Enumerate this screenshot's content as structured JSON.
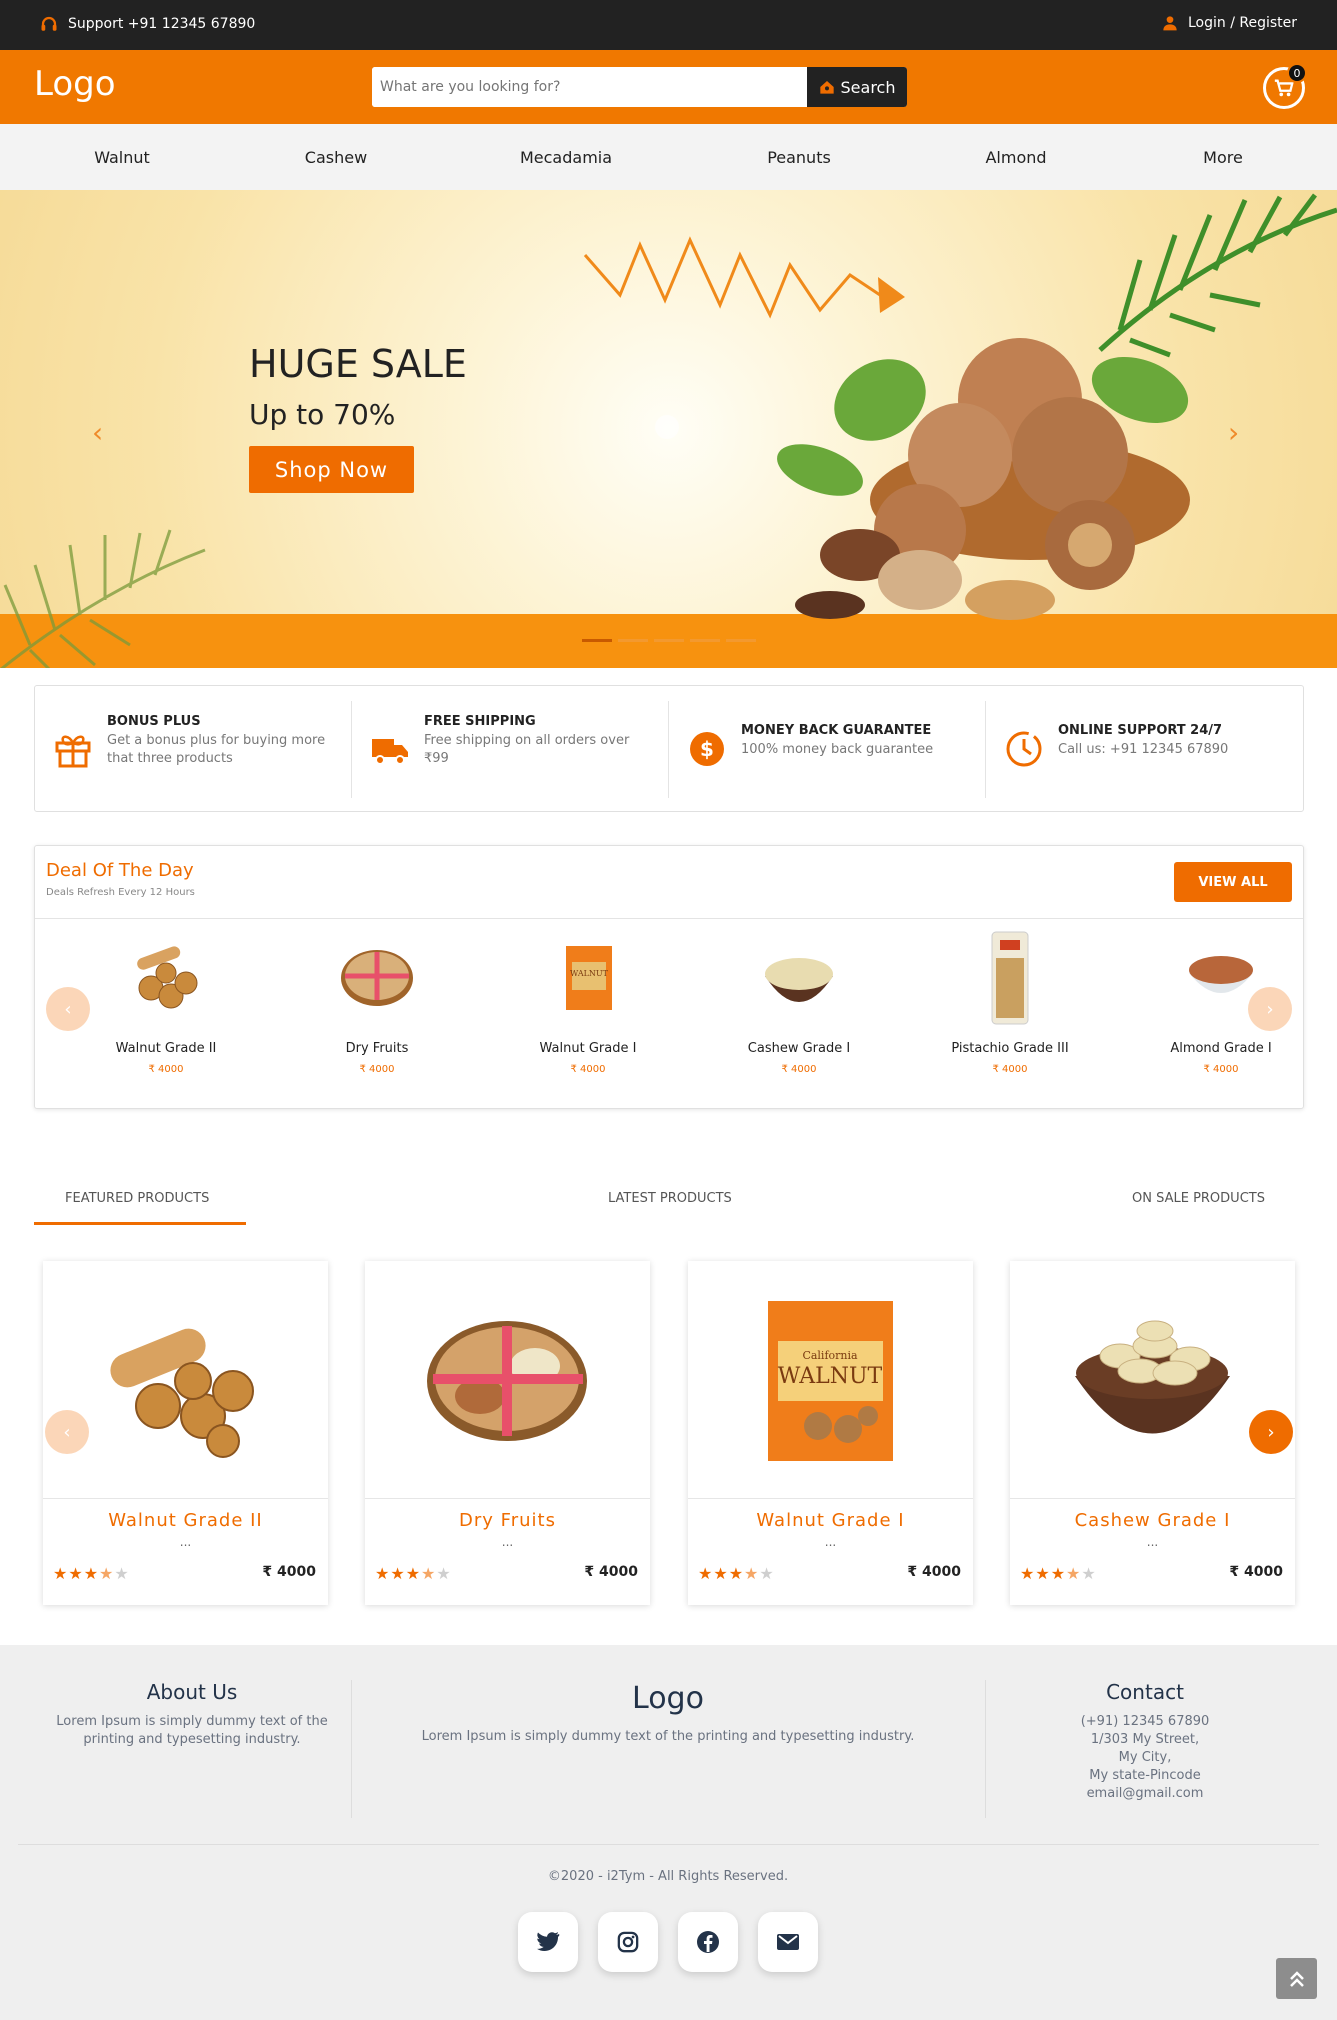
{
  "topbar": {
    "support": "Support +91 12345 67890",
    "login": "Login / Register"
  },
  "header": {
    "logo": "Logo",
    "search_placeholder": "What are you looking for?",
    "search_button": "Search",
    "cart_count": "0"
  },
  "nav": {
    "items": [
      "Walnut",
      "Cashew",
      "Mecadamia",
      "Peanuts",
      "Almond",
      "More"
    ]
  },
  "hero": {
    "title": "HUGE SALE",
    "subtitle": "Up to 70%",
    "cta": "Shop Now",
    "slide_count": 5,
    "active_slide": 1
  },
  "features": [
    {
      "title": "BONUS PLUS",
      "desc": "Get a bonus plus for buying more that three products",
      "icon": "gift-icon"
    },
    {
      "title": "FREE SHIPPING",
      "desc": "Free shipping on all orders over ₹99",
      "icon": "truck-icon"
    },
    {
      "title": "MONEY BACK GUARANTEE",
      "desc": "100% money back guarantee",
      "icon": "dollar-icon"
    },
    {
      "title": "ONLINE SUPPORT 24/7",
      "desc": "Call us: +91 12345 67890",
      "icon": "clock-icon"
    }
  ],
  "deal": {
    "title": "Deal Of The Day",
    "subtitle": "Deals Refresh Every 12 Hours",
    "view_all": "VIEW ALL",
    "items": [
      {
        "name": "Walnut Grade II",
        "price": "₹ 4000"
      },
      {
        "name": "Dry Fruits",
        "price": "₹ 4000"
      },
      {
        "name": "Walnut Grade I",
        "price": "₹ 4000"
      },
      {
        "name": "Cashew Grade I",
        "price": "₹ 4000"
      },
      {
        "name": "Pistachio Grade III",
        "price": "₹ 4000"
      },
      {
        "name": "Almond Grade I",
        "price": "₹ 4000"
      }
    ]
  },
  "tabs": [
    "FEATURED PRODUCTS",
    "LATEST PRODUCTS",
    "ON SALE PRODUCTS"
  ],
  "products": [
    {
      "name": "Walnut Grade II",
      "desc": "...",
      "price": "₹ 4000",
      "rating": 3.5
    },
    {
      "name": "Dry Fruits",
      "desc": "...",
      "price": "₹ 4000",
      "rating": 3.5
    },
    {
      "name": "Walnut Grade I",
      "desc": "...",
      "price": "₹ 4000",
      "rating": 3.5
    },
    {
      "name": "Cashew Grade I",
      "desc": "...",
      "price": "₹ 4000",
      "rating": 3.5
    }
  ],
  "product_box_text": {
    "line1": "California",
    "line2": "WALNUT"
  },
  "footer": {
    "about_title": "About Us",
    "about_text": "Lorem Ipsum is simply dummy text of the printing and typesetting industry.",
    "logo": "Logo",
    "logo_text": "Lorem Ipsum is simply dummy text of the printing and typesetting industry.",
    "contact_title": "Contact",
    "contact_lines": [
      "(+91) 12345 67890",
      "1/303 My Street,",
      "My City,",
      "My state-Pincode",
      "email@gmail.com"
    ],
    "copyright": "©2020 - i2Tym - All Rights Reserved.",
    "social": [
      "twitter-icon",
      "instagram-icon",
      "facebook-icon",
      "mail-icon"
    ]
  },
  "colors": {
    "accent": "#ef6c00",
    "header": "#f07800",
    "topbar": "#222222"
  }
}
